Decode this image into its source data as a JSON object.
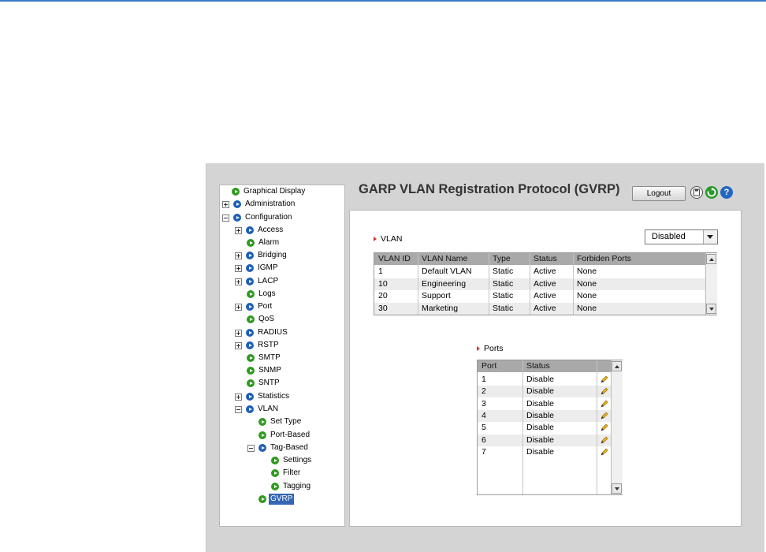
{
  "page": {
    "title": "GARP VLAN Registration Protocol (GVRP)"
  },
  "header": {
    "logout_label": "Logout",
    "icons": [
      "save-icon",
      "refresh-icon",
      "help-icon"
    ]
  },
  "nav": {
    "items": [
      {
        "label": "Graphical Display",
        "color": "green"
      },
      {
        "label": "Administration",
        "color": "blue",
        "expander": "plus"
      },
      {
        "label": "Configuration",
        "color": "blue",
        "expander": "minus"
      },
      {
        "label": "Access",
        "color": "blue",
        "expander": "plus"
      },
      {
        "label": "Alarm",
        "color": "green"
      },
      {
        "label": "Bridging",
        "color": "blue",
        "expander": "plus"
      },
      {
        "label": "IGMP",
        "color": "blue",
        "expander": "plus"
      },
      {
        "label": "LACP",
        "color": "blue",
        "expander": "plus"
      },
      {
        "label": "Logs",
        "color": "green"
      },
      {
        "label": "Port",
        "color": "blue",
        "expander": "plus"
      },
      {
        "label": "QoS",
        "color": "green"
      },
      {
        "label": "RADIUS",
        "color": "blue",
        "expander": "plus"
      },
      {
        "label": "RSTP",
        "color": "blue",
        "expander": "plus"
      },
      {
        "label": "SMTP",
        "color": "green"
      },
      {
        "label": "SNMP",
        "color": "green"
      },
      {
        "label": "SNTP",
        "color": "green"
      },
      {
        "label": "Statistics",
        "color": "blue",
        "expander": "plus"
      },
      {
        "label": "VLAN",
        "color": "blue",
        "expander": "minus"
      },
      {
        "label": "Set Type",
        "color": "green"
      },
      {
        "label": "Port-Based",
        "color": "green"
      },
      {
        "label": "Tag-Based",
        "color": "blue",
        "expander": "minus"
      },
      {
        "label": "Settings",
        "color": "green"
      },
      {
        "label": "Filter",
        "color": "green"
      },
      {
        "label": "Tagging",
        "color": "green"
      },
      {
        "label": "GVRP",
        "color": "green",
        "selected": true
      }
    ]
  },
  "vlan_section": {
    "label": "VLAN",
    "mode_select": "Disabled",
    "columns": [
      "VLAN ID",
      "VLAN Name",
      "Type",
      "Status",
      "Forbiden Ports"
    ],
    "rows": [
      [
        "1",
        "Default VLAN",
        "Static",
        "Active",
        "None"
      ],
      [
        "10",
        "Engineering",
        "Static",
        "Active",
        "None"
      ],
      [
        "20",
        "Support",
        "Static",
        "Active",
        "None"
      ],
      [
        "30",
        "Marketing",
        "Static",
        "Active",
        "None"
      ]
    ]
  },
  "ports_section": {
    "label": "Ports",
    "columns": [
      "Port",
      "Status"
    ],
    "rows": [
      [
        "1",
        "Disable"
      ],
      [
        "2",
        "Disable"
      ],
      [
        "3",
        "Disable"
      ],
      [
        "4",
        "Disable"
      ],
      [
        "5",
        "Disable"
      ],
      [
        "6",
        "Disable"
      ],
      [
        "7",
        "Disable"
      ]
    ]
  },
  "colors": {
    "accent": "#3466b5",
    "header_row": "#a9a9a9",
    "nav_green": "#2f9a1f",
    "nav_blue": "#1e5fb3",
    "section_arrow": "#c43a2a"
  }
}
